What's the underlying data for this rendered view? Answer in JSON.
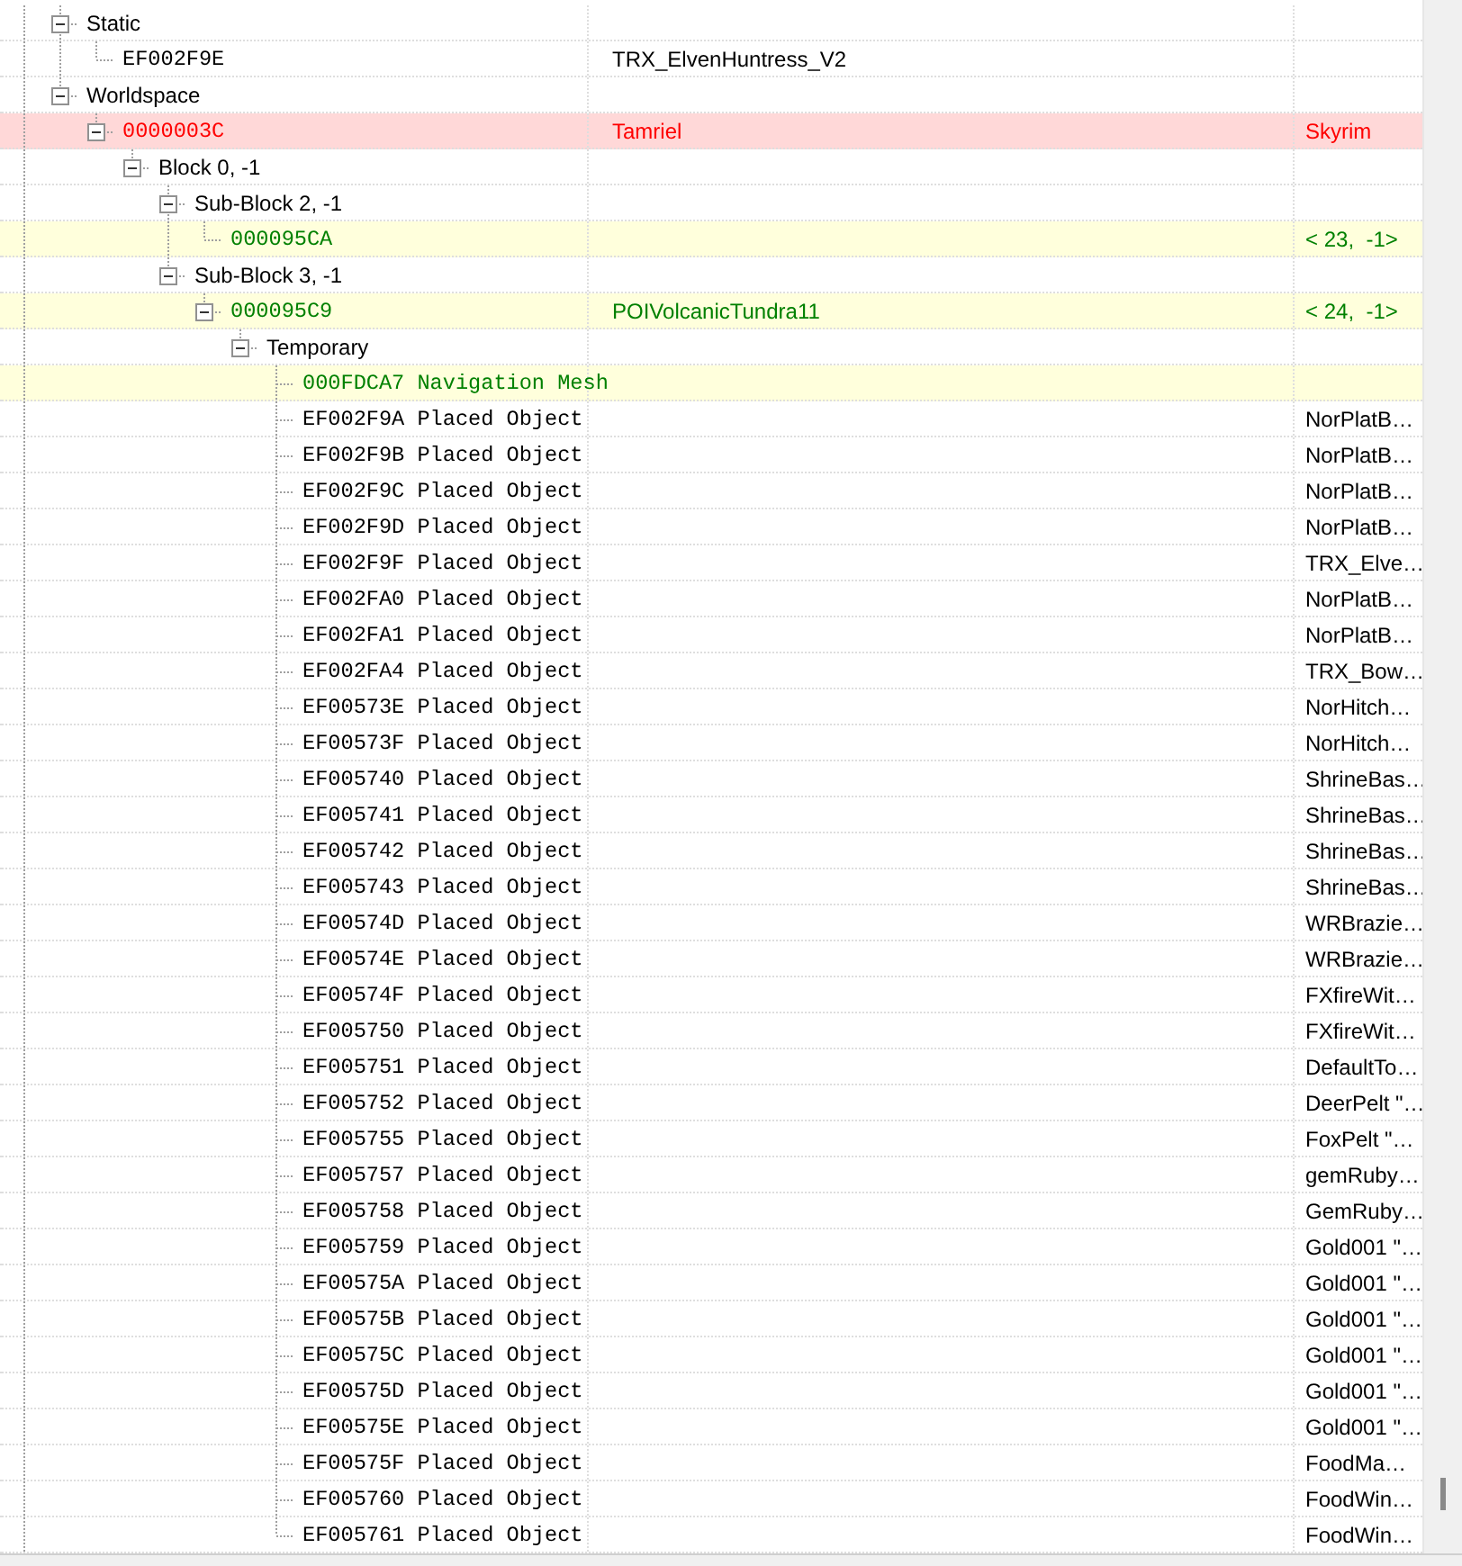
{
  "tree": [
    {
      "label": "Static",
      "kind": "group",
      "conflict": false,
      "override": false,
      "expanded": true,
      "children": [
        {
          "label": "EF002F9E",
          "kind": "record",
          "conflict": false,
          "override": false,
          "name": "TRX_ElvenHuntress_V2"
        }
      ]
    },
    {
      "label": "Worldspace",
      "kind": "group",
      "conflict": false,
      "override": false,
      "expanded": true,
      "children": [
        {
          "label": "0000003C",
          "kind": "record",
          "conflict": true,
          "override": false,
          "name": "Tamriel",
          "cell": "Skyrim",
          "expanded": true,
          "children": [
            {
              "label": "Block 0, -1",
              "kind": "group",
              "conflict": false,
              "override": false,
              "expanded": true,
              "children": [
                {
                  "label": "Sub-Block 2, -1",
                  "kind": "group",
                  "conflict": false,
                  "override": false,
                  "expanded": true,
                  "children": [
                    {
                      "label": "000095CA",
                      "kind": "record",
                      "conflict": false,
                      "override": true,
                      "cell": "< 23,  -1>"
                    }
                  ]
                },
                {
                  "label": "Sub-Block 3, -1",
                  "kind": "group",
                  "conflict": false,
                  "override": false,
                  "expanded": true,
                  "children": [
                    {
                      "label": "000095C9",
                      "kind": "record",
                      "conflict": false,
                      "override": true,
                      "name": "POIVolcanicTundra11",
                      "cell": "< 24,  -1>",
                      "expanded": true,
                      "children": [
                        {
                          "label": "Temporary",
                          "kind": "group",
                          "conflict": false,
                          "override": false,
                          "expanded": true,
                          "children": [
                            {
                              "label": "000FDCA7 Navigation Mesh",
                              "kind": "record",
                              "conflict": false,
                              "override": true
                            },
                            {
                              "label": "EF002F9A Placed Object",
                              "kind": "record",
                              "conflict": false,
                              "override": false,
                              "cell": "NorPlatB…"
                            },
                            {
                              "label": "EF002F9B Placed Object",
                              "kind": "record",
                              "conflict": false,
                              "override": false,
                              "cell": "NorPlatB…"
                            },
                            {
                              "label": "EF002F9C Placed Object",
                              "kind": "record",
                              "conflict": false,
                              "override": false,
                              "cell": "NorPlatB…"
                            },
                            {
                              "label": "EF002F9D Placed Object",
                              "kind": "record",
                              "conflict": false,
                              "override": false,
                              "cell": "NorPlatB…"
                            },
                            {
                              "label": "EF002F9F Placed Object",
                              "kind": "record",
                              "conflict": false,
                              "override": false,
                              "cell": "TRX_Elve…"
                            },
                            {
                              "label": "EF002FA0 Placed Object",
                              "kind": "record",
                              "conflict": false,
                              "override": false,
                              "cell": "NorPlatB…"
                            },
                            {
                              "label": "EF002FA1 Placed Object",
                              "kind": "record",
                              "conflict": false,
                              "override": false,
                              "cell": "NorPlatB…"
                            },
                            {
                              "label": "EF002FA4 Placed Object",
                              "kind": "record",
                              "conflict": false,
                              "override": false,
                              "cell": "TRX_Bow…"
                            },
                            {
                              "label": "EF00573E Placed Object",
                              "kind": "record",
                              "conflict": false,
                              "override": false,
                              "cell": "NorHitch…"
                            },
                            {
                              "label": "EF00573F Placed Object",
                              "kind": "record",
                              "conflict": false,
                              "override": false,
                              "cell": "NorHitch…"
                            },
                            {
                              "label": "EF005740 Placed Object",
                              "kind": "record",
                              "conflict": false,
                              "override": false,
                              "cell": "ShrineBas…"
                            },
                            {
                              "label": "EF005741 Placed Object",
                              "kind": "record",
                              "conflict": false,
                              "override": false,
                              "cell": "ShrineBas…"
                            },
                            {
                              "label": "EF005742 Placed Object",
                              "kind": "record",
                              "conflict": false,
                              "override": false,
                              "cell": "ShrineBas…"
                            },
                            {
                              "label": "EF005743 Placed Object",
                              "kind": "record",
                              "conflict": false,
                              "override": false,
                              "cell": "ShrineBas…"
                            },
                            {
                              "label": "EF00574D Placed Object",
                              "kind": "record",
                              "conflict": false,
                              "override": false,
                              "cell": "WRBrazie…"
                            },
                            {
                              "label": "EF00574E Placed Object",
                              "kind": "record",
                              "conflict": false,
                              "override": false,
                              "cell": "WRBrazie…"
                            },
                            {
                              "label": "EF00574F Placed Object",
                              "kind": "record",
                              "conflict": false,
                              "override": false,
                              "cell": "FXfireWit…"
                            },
                            {
                              "label": "EF005750 Placed Object",
                              "kind": "record",
                              "conflict": false,
                              "override": false,
                              "cell": "FXfireWit…"
                            },
                            {
                              "label": "EF005751 Placed Object",
                              "kind": "record",
                              "conflict": false,
                              "override": false,
                              "cell": "DefaultTo…"
                            },
                            {
                              "label": "EF005752 Placed Object",
                              "kind": "record",
                              "conflict": false,
                              "override": false,
                              "cell": "DeerPelt \"…"
                            },
                            {
                              "label": "EF005755 Placed Object",
                              "kind": "record",
                              "conflict": false,
                              "override": false,
                              "cell": "FoxPelt \"…"
                            },
                            {
                              "label": "EF005757 Placed Object",
                              "kind": "record",
                              "conflict": false,
                              "override": false,
                              "cell": "gemRuby…"
                            },
                            {
                              "label": "EF005758 Placed Object",
                              "kind": "record",
                              "conflict": false,
                              "override": false,
                              "cell": "GemRuby…"
                            },
                            {
                              "label": "EF005759 Placed Object",
                              "kind": "record",
                              "conflict": false,
                              "override": false,
                              "cell": "Gold001 \"…"
                            },
                            {
                              "label": "EF00575A Placed Object",
                              "kind": "record",
                              "conflict": false,
                              "override": false,
                              "cell": "Gold001 \"…"
                            },
                            {
                              "label": "EF00575B Placed Object",
                              "kind": "record",
                              "conflict": false,
                              "override": false,
                              "cell": "Gold001 \"…"
                            },
                            {
                              "label": "EF00575C Placed Object",
                              "kind": "record",
                              "conflict": false,
                              "override": false,
                              "cell": "Gold001 \"…"
                            },
                            {
                              "label": "EF00575D Placed Object",
                              "kind": "record",
                              "conflict": false,
                              "override": false,
                              "cell": "Gold001 \"…"
                            },
                            {
                              "label": "EF00575E Placed Object",
                              "kind": "record",
                              "conflict": false,
                              "override": false,
                              "cell": "Gold001 \"…"
                            },
                            {
                              "label": "EF00575F Placed Object",
                              "kind": "record",
                              "conflict": false,
                              "override": false,
                              "cell": "FoodMa…"
                            },
                            {
                              "label": "EF005760 Placed Object",
                              "kind": "record",
                              "conflict": false,
                              "override": false,
                              "cell": "FoodWin…"
                            },
                            {
                              "label": "EF005761 Placed Object",
                              "kind": "record",
                              "conflict": false,
                              "override": false,
                              "cell": "FoodWin…"
                            }
                          ]
                        }
                      ]
                    }
                  ]
                }
              ]
            }
          ]
        }
      ]
    }
  ]
}
